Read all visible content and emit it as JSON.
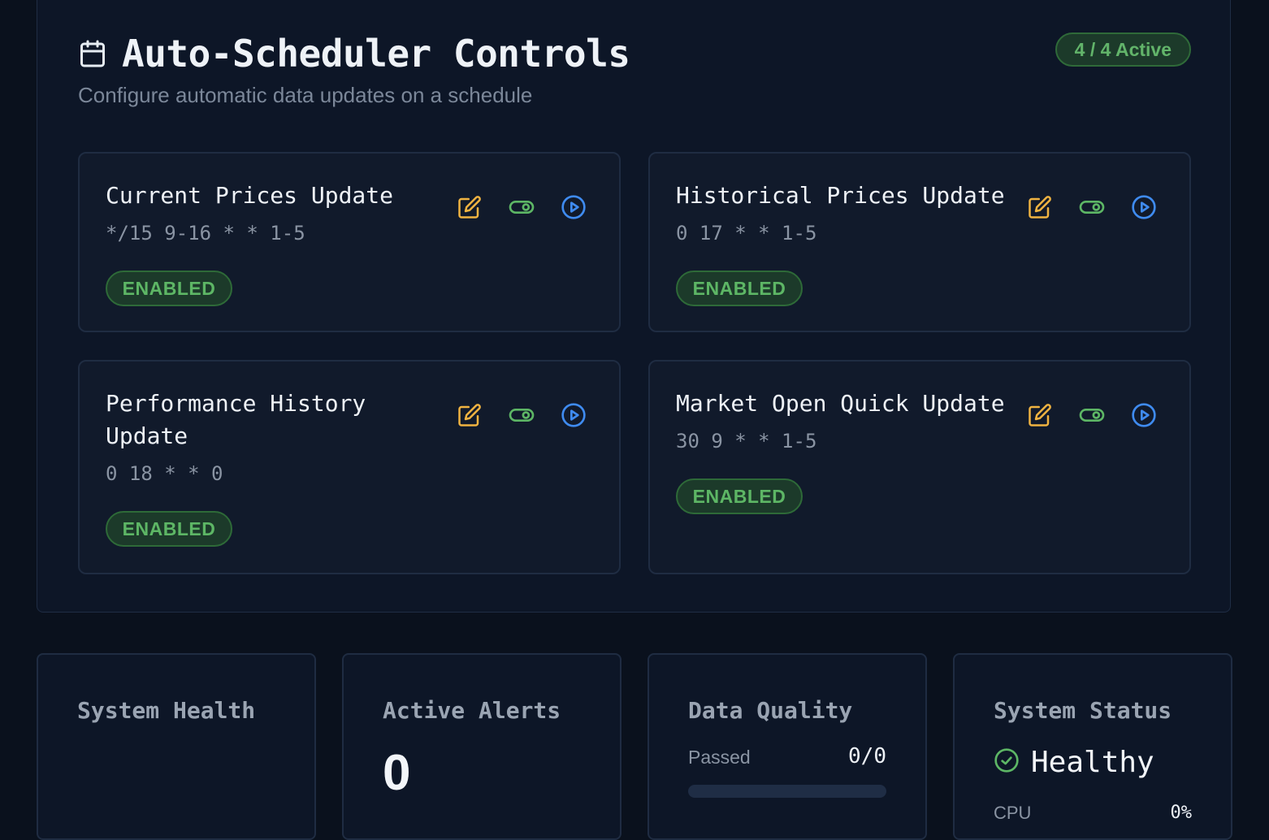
{
  "scheduler": {
    "title": "Auto-Scheduler Controls",
    "subtitle": "Configure automatic data updates on a schedule",
    "active_count": "4 / 4 Active",
    "jobs": [
      {
        "name": "Current Prices Update",
        "cron": "*/15 9-16 * * 1-5",
        "status": "ENABLED"
      },
      {
        "name": "Historical Prices Update",
        "cron": "0 17 * * 1-5",
        "status": "ENABLED"
      },
      {
        "name": "Performance History Update",
        "cron": "0 18 * * 0",
        "status": "ENABLED"
      },
      {
        "name": "Market Open Quick Update",
        "cron": "30 9 * * 1-5",
        "status": "ENABLED"
      }
    ],
    "icons": {
      "header": "calendar-icon",
      "edit": "edit-icon",
      "toggle": "toggle-icon",
      "run": "play-circle-icon"
    }
  },
  "stats": {
    "system_health": {
      "title": "System Health"
    },
    "active_alerts": {
      "title": "Active Alerts",
      "value": "0"
    },
    "data_quality": {
      "title": "Data Quality",
      "label": "Passed",
      "value": "0/0",
      "fraction": 0
    },
    "system_status": {
      "title": "System Status",
      "status": "Healthy",
      "cpu_label": "CPU",
      "cpu_value": "0%"
    }
  },
  "colors": {
    "background": "#0a111d",
    "panel": "#0d1627",
    "edit": "#f0b341",
    "toggle": "#5db665",
    "run": "#3f8bf0",
    "success": "#5db665"
  }
}
